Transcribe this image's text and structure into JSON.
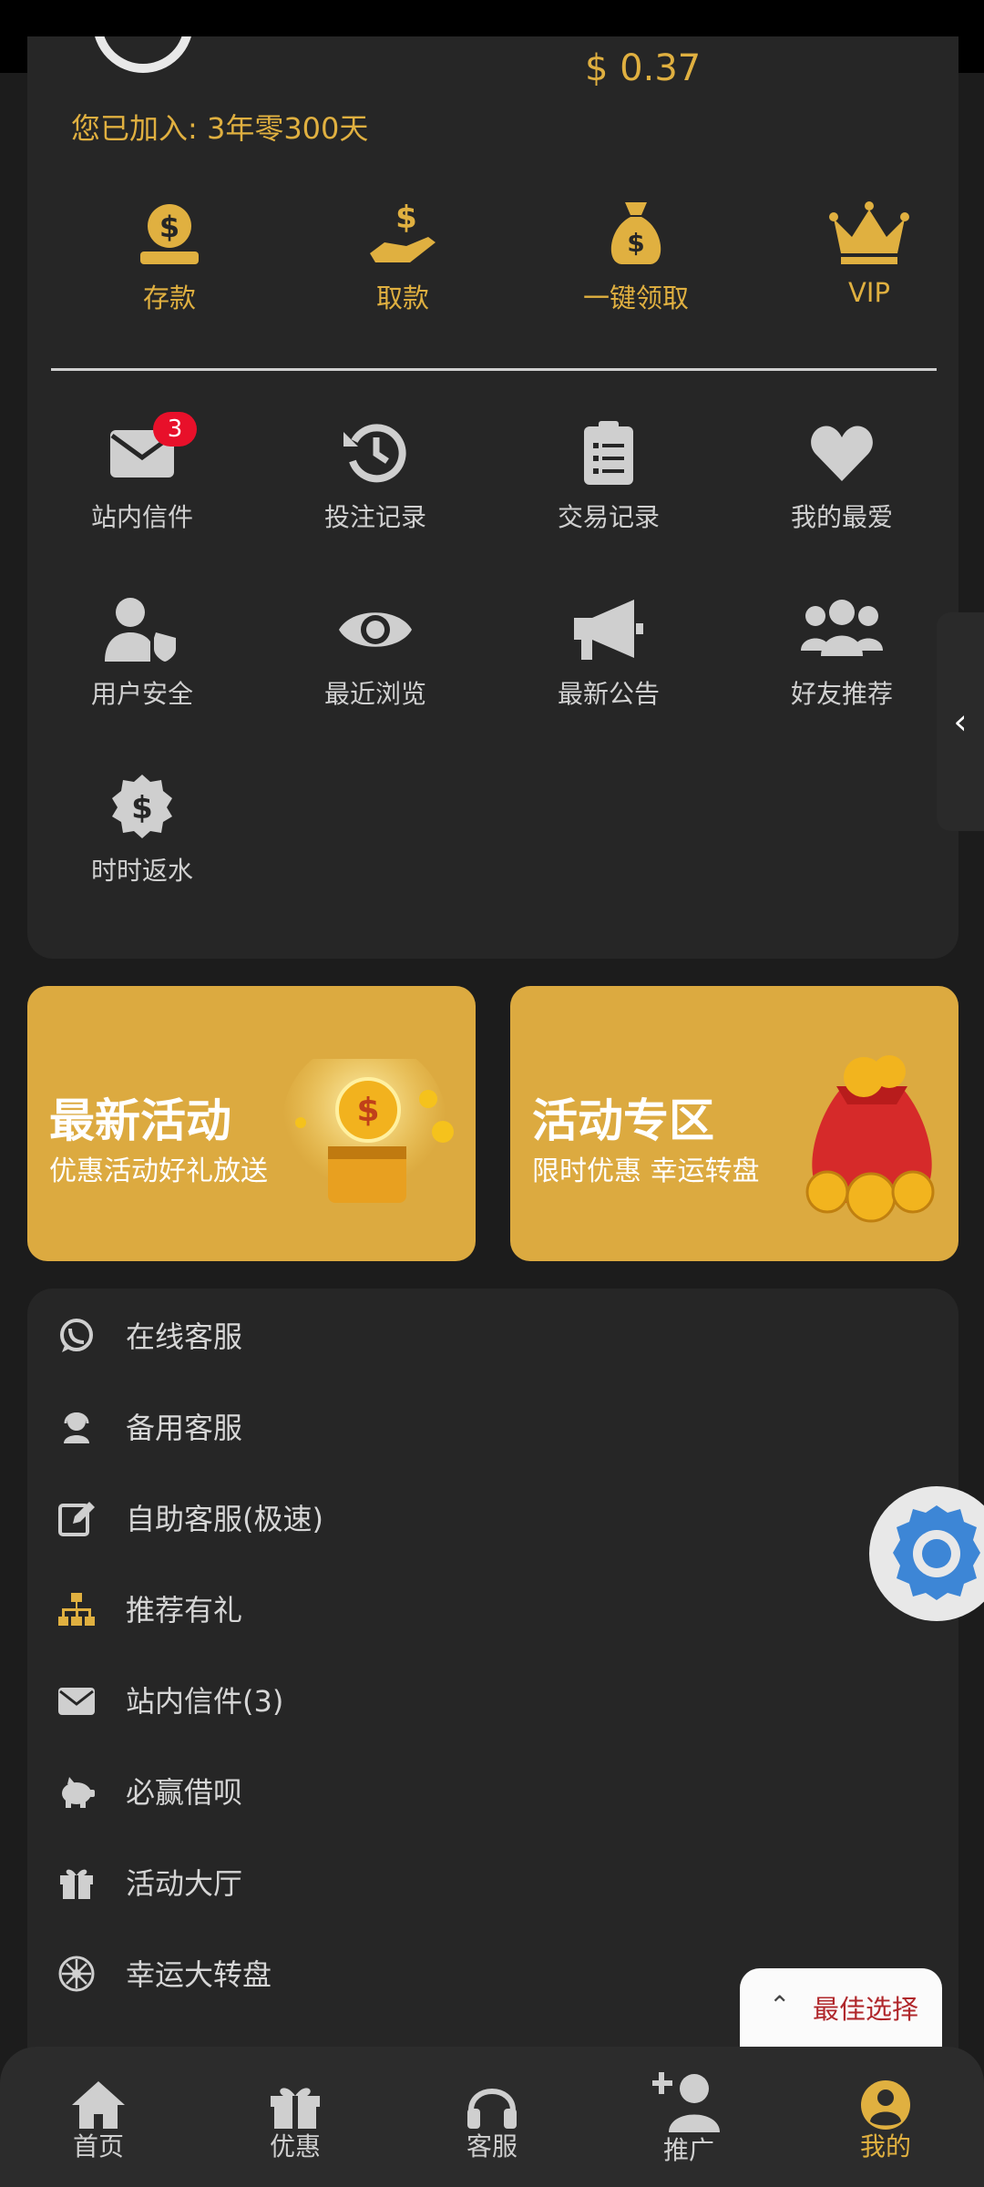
{
  "profile": {
    "balance_partial": "$ 0.37",
    "joined_text": "您已加入: 3年零300天"
  },
  "quick_actions": [
    {
      "label": "存款",
      "icon": "deposit-icon"
    },
    {
      "label": "取款",
      "icon": "withdraw-icon"
    },
    {
      "label": "一键领取",
      "icon": "money-bag-icon"
    },
    {
      "label": "VIP",
      "icon": "crown-icon"
    }
  ],
  "grid": [
    {
      "label": "站内信件",
      "icon": "mail-icon",
      "badge": "3"
    },
    {
      "label": "投注记录",
      "icon": "history-icon"
    },
    {
      "label": "交易记录",
      "icon": "clipboard-icon"
    },
    {
      "label": "我的最爱",
      "icon": "heart-icon"
    },
    {
      "label": "用户安全",
      "icon": "user-shield-icon"
    },
    {
      "label": "最近浏览",
      "icon": "eye-icon"
    },
    {
      "label": "最新公告",
      "icon": "megaphone-icon"
    },
    {
      "label": "好友推荐",
      "icon": "users-icon"
    },
    {
      "label": "时时返水",
      "icon": "dollar-badge-icon"
    }
  ],
  "side_tab": {
    "label": "‹"
  },
  "banners": [
    {
      "title": "最新活动",
      "subtitle": "优惠活动好礼放送",
      "icon": "treasure-chest-icon"
    },
    {
      "title": "活动专区",
      "subtitle": "限时优惠 幸运转盘",
      "icon": "coin-bag-icon"
    }
  ],
  "menu": [
    {
      "label": "在线客服",
      "icon": "whatsapp-icon"
    },
    {
      "label": "备用客服",
      "icon": "headset-agent-icon"
    },
    {
      "label": "自助客服(极速)",
      "icon": "edit-icon"
    },
    {
      "label": "推荐有礼",
      "icon": "sitemap-icon",
      "color": "#e0b040"
    },
    {
      "label": "站内信件(3)",
      "icon": "envelope-icon"
    },
    {
      "label": "必赢借呗",
      "icon": "piggy-bank-icon"
    },
    {
      "label": "活动大厅",
      "icon": "gift-icon"
    },
    {
      "label": "幸运大转盘",
      "icon": "wheel-icon"
    }
  ],
  "best_choice": {
    "label": "最佳选择",
    "chevron": "⌃"
  },
  "bottom_nav": [
    {
      "label": "首页",
      "icon": "home-icon"
    },
    {
      "label": "优惠",
      "icon": "gift-icon"
    },
    {
      "label": "客服",
      "icon": "headphones-icon"
    },
    {
      "label": "推广",
      "icon": "user-plus-icon"
    },
    {
      "label": "我的",
      "icon": "user-circle-icon",
      "active": true
    }
  ],
  "colors": {
    "accent": "#e0b040",
    "badge": "#e8102a",
    "background": "#1c1c1c",
    "card": "#262626"
  }
}
